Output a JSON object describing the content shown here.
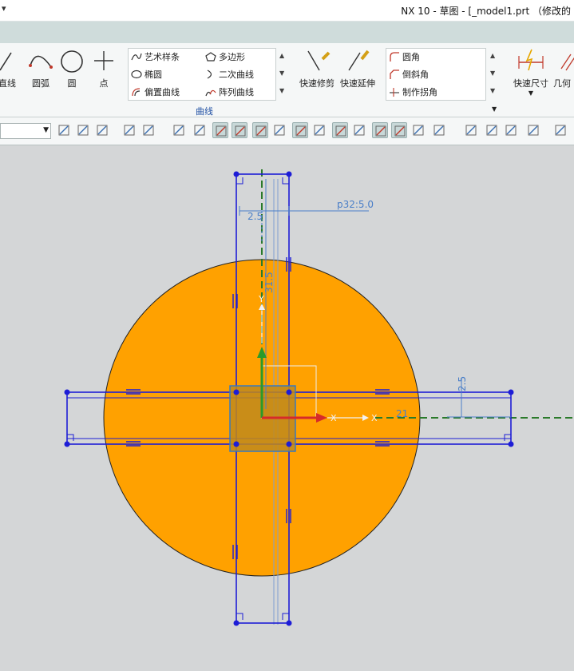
{
  "window": {
    "title": "NX 10 - 草图 - [_model1.prt （修改的",
    "quick_access_icon": "dropdown-arrow-icon"
  },
  "ribbon": {
    "buttons": [
      {
        "label": "直线",
        "icon": "line-icon"
      },
      {
        "label": "圆弧",
        "icon": "arc-icon"
      },
      {
        "label": "圆",
        "icon": "circle-icon"
      },
      {
        "label": "点",
        "icon": "point-icon"
      }
    ],
    "curve_gallery": [
      {
        "label": "艺术样条",
        "icon": "spline-icon"
      },
      {
        "label": "多边形",
        "icon": "polygon-icon"
      },
      {
        "label": "椭圆",
        "icon": "ellipse-icon"
      },
      {
        "label": "二次曲线",
        "icon": "conic-icon"
      },
      {
        "label": "偏置曲线",
        "icon": "offset-curve-icon"
      },
      {
        "label": "阵列曲线",
        "icon": "pattern-curve-icon"
      }
    ],
    "edit_buttons": [
      {
        "label": "快速修剪",
        "icon": "quick-trim-icon"
      },
      {
        "label": "快速延伸",
        "icon": "quick-extend-icon"
      }
    ],
    "corner_gallery": [
      {
        "label": "圆角",
        "icon": "fillet-icon"
      },
      {
        "label": "倒斜角",
        "icon": "chamfer-icon"
      },
      {
        "label": "制作拐角",
        "icon": "make-corner-icon"
      }
    ],
    "dim_buttons": [
      {
        "label": "快速尺寸",
        "icon": "rapid-dimension-icon"
      },
      {
        "label": "几何",
        "icon": "geometric-constraints-icon"
      }
    ],
    "group_label": "曲线"
  },
  "sketch": {
    "dimensions": {
      "p32": "p32:5.0",
      "width_label": "2.5",
      "height_label": "31.5",
      "right_width": "2.5",
      "right_length": "21"
    },
    "axes": {
      "x": "X",
      "y": "Y"
    },
    "colors": {
      "disk": "#ffa100",
      "sketch_line": "#1d1dd6",
      "dimension": "#4a7fc8",
      "selected_square": "#c08a1c",
      "axis_x": "#d62a2a",
      "axis_y": "#2a9a2a",
      "datum_dashed": "#2a7a2a",
      "background": "#d4d6d7"
    }
  }
}
